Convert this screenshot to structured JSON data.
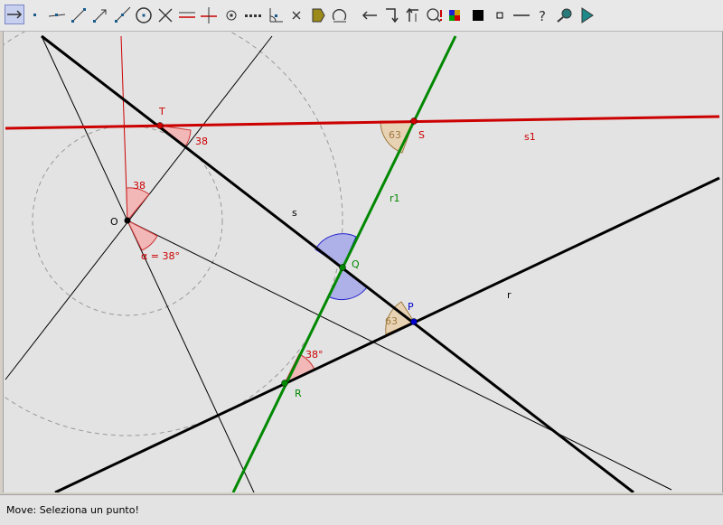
{
  "toolbar": {
    "tools": [
      {
        "name": "move-tool-icon",
        "active": true
      },
      {
        "name": "point-tool-icon"
      },
      {
        "name": "line-through-two-points-icon"
      },
      {
        "name": "segment-icon"
      },
      {
        "name": "vector-icon"
      },
      {
        "name": "ray-icon"
      },
      {
        "name": "circle-center-point-icon"
      },
      {
        "name": "intersect-icon"
      },
      {
        "name": "parallel-line-icon"
      },
      {
        "name": "perpendicular-line-icon"
      },
      {
        "name": "midpoint-icon"
      },
      {
        "name": "locus-icon"
      },
      {
        "name": "angle-icon"
      },
      {
        "name": "delete-icon"
      },
      {
        "name": "polygon-icon"
      },
      {
        "name": "rotate-icon"
      },
      {
        "name": "move-graphics-view-icon"
      },
      {
        "name": "reflect-icon"
      },
      {
        "name": "translate-icon"
      },
      {
        "name": "text-icon"
      },
      {
        "name": "color-icon"
      },
      {
        "name": "square-icon"
      },
      {
        "name": "small-square-icon"
      },
      {
        "name": "line-style-icon"
      },
      {
        "name": "help-icon"
      },
      {
        "name": "zoom-icon"
      },
      {
        "name": "play-icon"
      }
    ]
  },
  "canvas": {
    "points": {
      "O": "O",
      "T": "T",
      "S": "S",
      "Q": "Q",
      "P": "P",
      "R": "R"
    },
    "lines": {
      "s": "s",
      "r": "r",
      "r1": "r1",
      "s1": "s1"
    },
    "angles": {
      "at_T": "38",
      "at_O_upper": "38",
      "at_O_lower": "α = 38°",
      "at_S": "63",
      "at_P": "63",
      "at_R": "38°"
    },
    "colors": {
      "red": "#cc0000",
      "green": "#008800",
      "black": "#000000",
      "blue": "#0000cc",
      "angle_red_fill": "#f2b8b8",
      "angle_tan_fill": "#e8d2b4",
      "angle_blue_fill": "#aeb0e8"
    }
  },
  "status": {
    "text": "Move: Seleziona un punto!"
  }
}
